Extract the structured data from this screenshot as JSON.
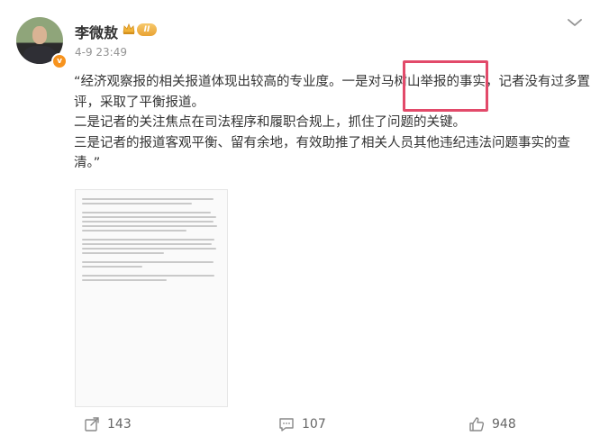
{
  "post": {
    "author": {
      "name": "李微敖",
      "level_badge": "II",
      "verified_icon": "verified-badge-icon"
    },
    "timestamp": "4-9 23:49",
    "content": {
      "paragraphs": [
        "“经济观察报的相关报道体现出较高的专业度。一是对马树山举报的事实，记者没有过多置评，采取了平衡报道。",
        "二是记者的关注焦点在司法程序和履职合规上，抓住了问题的关键。",
        "三是记者的报道客观平衡、留有余地，有效助推了相关人员其他违纪违法问题事实的查清。”"
      ],
      "highlighted_text": "对马树山举报"
    },
    "colors": {
      "highlight_border": "#e24a6a",
      "badge": "#f7931e",
      "text": "#333333",
      "muted": "#939393"
    },
    "actions": {
      "share_count": "143",
      "comment_count": "107",
      "like_count": "948"
    }
  }
}
